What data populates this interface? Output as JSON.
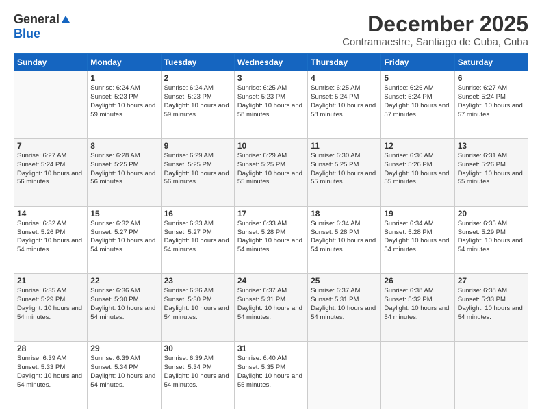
{
  "logo": {
    "general": "General",
    "blue": "Blue"
  },
  "header": {
    "title": "December 2025",
    "subtitle": "Contramaestre, Santiago de Cuba, Cuba"
  },
  "weekdays": [
    "Sunday",
    "Monday",
    "Tuesday",
    "Wednesday",
    "Thursday",
    "Friday",
    "Saturday"
  ],
  "weeks": [
    [
      {
        "day": "",
        "sunrise": "",
        "sunset": "",
        "daylight": ""
      },
      {
        "day": "1",
        "sunrise": "Sunrise: 6:24 AM",
        "sunset": "Sunset: 5:23 PM",
        "daylight": "Daylight: 10 hours and 59 minutes."
      },
      {
        "day": "2",
        "sunrise": "Sunrise: 6:24 AM",
        "sunset": "Sunset: 5:23 PM",
        "daylight": "Daylight: 10 hours and 59 minutes."
      },
      {
        "day": "3",
        "sunrise": "Sunrise: 6:25 AM",
        "sunset": "Sunset: 5:23 PM",
        "daylight": "Daylight: 10 hours and 58 minutes."
      },
      {
        "day": "4",
        "sunrise": "Sunrise: 6:25 AM",
        "sunset": "Sunset: 5:24 PM",
        "daylight": "Daylight: 10 hours and 58 minutes."
      },
      {
        "day": "5",
        "sunrise": "Sunrise: 6:26 AM",
        "sunset": "Sunset: 5:24 PM",
        "daylight": "Daylight: 10 hours and 57 minutes."
      },
      {
        "day": "6",
        "sunrise": "Sunrise: 6:27 AM",
        "sunset": "Sunset: 5:24 PM",
        "daylight": "Daylight: 10 hours and 57 minutes."
      }
    ],
    [
      {
        "day": "7",
        "sunrise": "Sunrise: 6:27 AM",
        "sunset": "Sunset: 5:24 PM",
        "daylight": "Daylight: 10 hours and 56 minutes."
      },
      {
        "day": "8",
        "sunrise": "Sunrise: 6:28 AM",
        "sunset": "Sunset: 5:25 PM",
        "daylight": "Daylight: 10 hours and 56 minutes."
      },
      {
        "day": "9",
        "sunrise": "Sunrise: 6:29 AM",
        "sunset": "Sunset: 5:25 PM",
        "daylight": "Daylight: 10 hours and 56 minutes."
      },
      {
        "day": "10",
        "sunrise": "Sunrise: 6:29 AM",
        "sunset": "Sunset: 5:25 PM",
        "daylight": "Daylight: 10 hours and 55 minutes."
      },
      {
        "day": "11",
        "sunrise": "Sunrise: 6:30 AM",
        "sunset": "Sunset: 5:25 PM",
        "daylight": "Daylight: 10 hours and 55 minutes."
      },
      {
        "day": "12",
        "sunrise": "Sunrise: 6:30 AM",
        "sunset": "Sunset: 5:26 PM",
        "daylight": "Daylight: 10 hours and 55 minutes."
      },
      {
        "day": "13",
        "sunrise": "Sunrise: 6:31 AM",
        "sunset": "Sunset: 5:26 PM",
        "daylight": "Daylight: 10 hours and 55 minutes."
      }
    ],
    [
      {
        "day": "14",
        "sunrise": "Sunrise: 6:32 AM",
        "sunset": "Sunset: 5:26 PM",
        "daylight": "Daylight: 10 hours and 54 minutes."
      },
      {
        "day": "15",
        "sunrise": "Sunrise: 6:32 AM",
        "sunset": "Sunset: 5:27 PM",
        "daylight": "Daylight: 10 hours and 54 minutes."
      },
      {
        "day": "16",
        "sunrise": "Sunrise: 6:33 AM",
        "sunset": "Sunset: 5:27 PM",
        "daylight": "Daylight: 10 hours and 54 minutes."
      },
      {
        "day": "17",
        "sunrise": "Sunrise: 6:33 AM",
        "sunset": "Sunset: 5:28 PM",
        "daylight": "Daylight: 10 hours and 54 minutes."
      },
      {
        "day": "18",
        "sunrise": "Sunrise: 6:34 AM",
        "sunset": "Sunset: 5:28 PM",
        "daylight": "Daylight: 10 hours and 54 minutes."
      },
      {
        "day": "19",
        "sunrise": "Sunrise: 6:34 AM",
        "sunset": "Sunset: 5:28 PM",
        "daylight": "Daylight: 10 hours and 54 minutes."
      },
      {
        "day": "20",
        "sunrise": "Sunrise: 6:35 AM",
        "sunset": "Sunset: 5:29 PM",
        "daylight": "Daylight: 10 hours and 54 minutes."
      }
    ],
    [
      {
        "day": "21",
        "sunrise": "Sunrise: 6:35 AM",
        "sunset": "Sunset: 5:29 PM",
        "daylight": "Daylight: 10 hours and 54 minutes."
      },
      {
        "day": "22",
        "sunrise": "Sunrise: 6:36 AM",
        "sunset": "Sunset: 5:30 PM",
        "daylight": "Daylight: 10 hours and 54 minutes."
      },
      {
        "day": "23",
        "sunrise": "Sunrise: 6:36 AM",
        "sunset": "Sunset: 5:30 PM",
        "daylight": "Daylight: 10 hours and 54 minutes."
      },
      {
        "day": "24",
        "sunrise": "Sunrise: 6:37 AM",
        "sunset": "Sunset: 5:31 PM",
        "daylight": "Daylight: 10 hours and 54 minutes."
      },
      {
        "day": "25",
        "sunrise": "Sunrise: 6:37 AM",
        "sunset": "Sunset: 5:31 PM",
        "daylight": "Daylight: 10 hours and 54 minutes."
      },
      {
        "day": "26",
        "sunrise": "Sunrise: 6:38 AM",
        "sunset": "Sunset: 5:32 PM",
        "daylight": "Daylight: 10 hours and 54 minutes."
      },
      {
        "day": "27",
        "sunrise": "Sunrise: 6:38 AM",
        "sunset": "Sunset: 5:33 PM",
        "daylight": "Daylight: 10 hours and 54 minutes."
      }
    ],
    [
      {
        "day": "28",
        "sunrise": "Sunrise: 6:39 AM",
        "sunset": "Sunset: 5:33 PM",
        "daylight": "Daylight: 10 hours and 54 minutes."
      },
      {
        "day": "29",
        "sunrise": "Sunrise: 6:39 AM",
        "sunset": "Sunset: 5:34 PM",
        "daylight": "Daylight: 10 hours and 54 minutes."
      },
      {
        "day": "30",
        "sunrise": "Sunrise: 6:39 AM",
        "sunset": "Sunset: 5:34 PM",
        "daylight": "Daylight: 10 hours and 54 minutes."
      },
      {
        "day": "31",
        "sunrise": "Sunrise: 6:40 AM",
        "sunset": "Sunset: 5:35 PM",
        "daylight": "Daylight: 10 hours and 55 minutes."
      },
      {
        "day": "",
        "sunrise": "",
        "sunset": "",
        "daylight": ""
      },
      {
        "day": "",
        "sunrise": "",
        "sunset": "",
        "daylight": ""
      },
      {
        "day": "",
        "sunrise": "",
        "sunset": "",
        "daylight": ""
      }
    ]
  ]
}
